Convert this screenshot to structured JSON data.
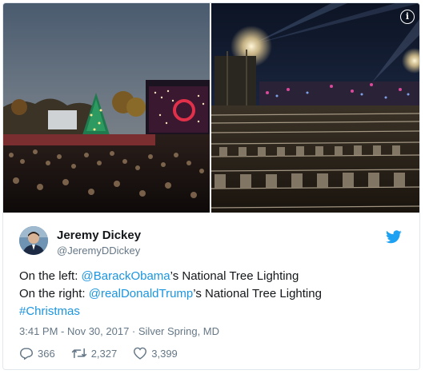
{
  "tweet": {
    "author_name": "Jeremy Dickey",
    "author_handle": "@JeremyDDickey",
    "line1_prefix": "On the left: ",
    "line1_mention": "@BarackObama",
    "line1_suffix": "’s National Tree Lighting",
    "line2_prefix": "On the right: ",
    "line2_mention": "@realDonaldTrump",
    "line2_suffix": "’s National Tree Lighting",
    "hashtag": "#Christmas",
    "timestamp": "3:41 PM - Nov 30, 2017",
    "location_separator": " · ",
    "location": "Silver Spring, MD"
  },
  "actions": {
    "reply_count": "366",
    "retweet_count": "2,327",
    "like_count": "3,399"
  },
  "icons": {
    "info": "info-icon",
    "twitter": "twitter-bird-icon",
    "reply": "reply-icon",
    "retweet": "retweet-icon",
    "like": "heart-icon"
  },
  "colors": {
    "link": "#1b95e0",
    "secondary_text": "#657786",
    "primary_text": "#14171a",
    "twitter_blue": "#1da1f2"
  }
}
